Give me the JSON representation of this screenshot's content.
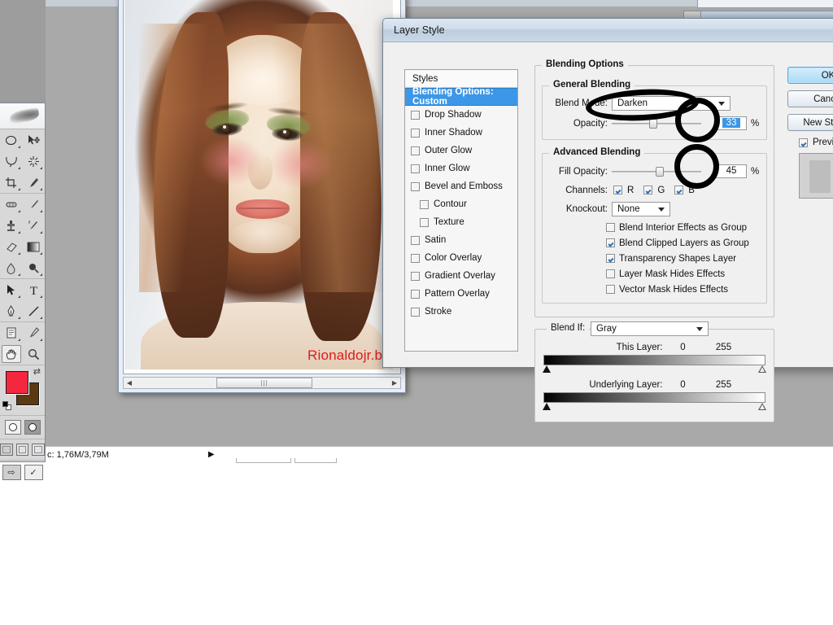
{
  "app": {
    "status_bar": {
      "doc_size": "c: 1,76M/3,79M",
      "expand_arrow": "▶"
    }
  },
  "document_window": {
    "watermark": "Rionaldojr.blogspot.com",
    "scroll_left_arrow": "◀",
    "scroll_right_arrow": "▶",
    "scroll_grip": "|||"
  },
  "toolbar": {
    "tools": [
      {
        "name": "marquee-elliptical-tool",
        "glyph": "◯"
      },
      {
        "name": "move-tool",
        "glyph": "✥"
      },
      {
        "name": "lasso-tool",
        "glyph": "〽"
      },
      {
        "name": "magic-wand-tool",
        "glyph": "✳"
      },
      {
        "name": "crop-tool",
        "glyph": "⌗"
      },
      {
        "name": "slice-tool",
        "glyph": "✂"
      },
      {
        "name": "healing-brush-tool",
        "glyph": "🩹"
      },
      {
        "name": "brush-tool",
        "glyph": "✎"
      },
      {
        "name": "clone-stamp-tool",
        "glyph": "⚲"
      },
      {
        "name": "history-brush-tool",
        "glyph": "✐"
      },
      {
        "name": "eraser-tool",
        "glyph": "▱"
      },
      {
        "name": "gradient-tool",
        "glyph": "▤"
      },
      {
        "name": "blur-tool",
        "glyph": "💧"
      },
      {
        "name": "dodge-tool",
        "glyph": "🔍"
      },
      {
        "name": "path-selection-tool",
        "glyph": "➤"
      },
      {
        "name": "type-tool",
        "glyph": "T"
      },
      {
        "name": "pen-tool",
        "glyph": "✒"
      },
      {
        "name": "line-tool",
        "glyph": "╲"
      },
      {
        "name": "notes-tool",
        "glyph": "🗒"
      },
      {
        "name": "eyedropper-tool",
        "glyph": "💉"
      },
      {
        "name": "hand-tool",
        "glyph": "✋"
      },
      {
        "name": "zoom-tool",
        "glyph": "🔎"
      }
    ],
    "colors": {
      "foreground": "#f5273f",
      "background": "#5b3a12"
    },
    "swap_icon": "⇄",
    "quickmask": {
      "standard": "standard-mode",
      "quickmask": "quick-mask-mode"
    },
    "screen_modes": [
      "standard-screen-mode",
      "full-screen-menubar",
      "full-screen"
    ],
    "jump_to": "jump-to-imageready"
  },
  "dialog": {
    "title": "Layer Style",
    "styles_header": "Styles",
    "styles": [
      {
        "label": "Blending Options: Custom",
        "selected": true,
        "checkbox": false
      },
      {
        "label": "Drop Shadow",
        "checked": false,
        "indent": false
      },
      {
        "label": "Inner Shadow",
        "checked": false,
        "indent": false
      },
      {
        "label": "Outer Glow",
        "checked": false,
        "indent": false
      },
      {
        "label": "Inner Glow",
        "checked": false,
        "indent": false
      },
      {
        "label": "Bevel and Emboss",
        "checked": false,
        "indent": false
      },
      {
        "label": "Contour",
        "checked": false,
        "indent": true
      },
      {
        "label": "Texture",
        "checked": false,
        "indent": true
      },
      {
        "label": "Satin",
        "checked": false,
        "indent": false
      },
      {
        "label": "Color Overlay",
        "checked": false,
        "indent": false
      },
      {
        "label": "Gradient Overlay",
        "checked": false,
        "indent": false
      },
      {
        "label": "Pattern Overlay",
        "checked": false,
        "indent": false
      },
      {
        "label": "Stroke",
        "checked": false,
        "indent": false
      }
    ],
    "blending_options": {
      "legend": "Blending Options",
      "general": {
        "legend": "General Blending",
        "blend_mode_label": "Blend Mode:",
        "blend_mode_value": "Darken",
        "opacity_label": "Opacity:",
        "opacity_value": "33",
        "opacity_unit": "%"
      },
      "advanced": {
        "legend": "Advanced Blending",
        "fill_opacity_label": "Fill Opacity:",
        "fill_opacity_value": "45",
        "fill_opacity_unit": "%",
        "channels_label": "Channels:",
        "channels": [
          {
            "label": "R",
            "checked": true
          },
          {
            "label": "G",
            "checked": true
          },
          {
            "label": "B",
            "checked": true
          }
        ],
        "knockout_label": "Knockout:",
        "knockout_value": "None",
        "options": [
          {
            "label": "Blend Interior Effects as Group",
            "checked": false
          },
          {
            "label": "Blend Clipped Layers as Group",
            "checked": true
          },
          {
            "label": "Transparency Shapes Layer",
            "checked": true
          },
          {
            "label": "Layer Mask Hides Effects",
            "checked": false
          },
          {
            "label": "Vector Mask Hides Effects",
            "checked": false
          }
        ]
      },
      "blend_if": {
        "label": "Blend If:",
        "value": "Gray",
        "this_layer_label": "This Layer:",
        "this_layer_min": "0",
        "this_layer_max": "255",
        "underlying_layer_label": "Underlying Layer:",
        "underlying_layer_min": "0",
        "underlying_layer_max": "255"
      }
    },
    "buttons": {
      "ok": "OK",
      "cancel": "Cancel",
      "new_style": "New Style...",
      "preview_label": "Preview",
      "preview_checked": true
    }
  },
  "annotations": {
    "circle_blend_mode": "hand-drawn-circle-blend-mode",
    "circle_opacity": "hand-drawn-circle-opacity",
    "circle_fill_opacity": "hand-drawn-circle-fill-opacity"
  }
}
